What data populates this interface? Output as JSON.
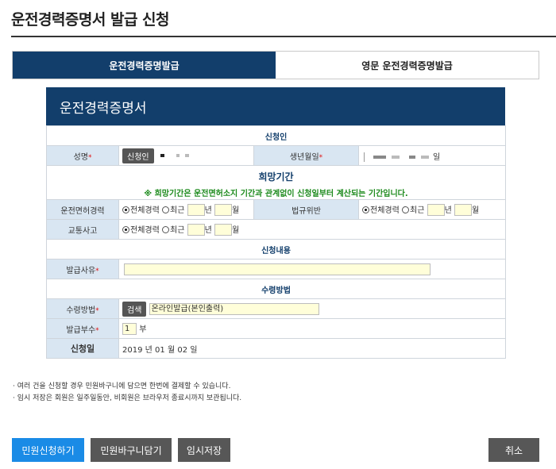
{
  "page_title": "운전경력증명서 발급 신청",
  "tabs": [
    {
      "label": "운전경력증명발급",
      "active": true
    },
    {
      "label": "영문 운전경력증명발급",
      "active": false
    }
  ],
  "form": {
    "header": "운전경력증명서",
    "sections": {
      "applicant": "신청인",
      "period": "희망기간",
      "content": "신청내용",
      "receipt": "수령방법"
    },
    "applicant": {
      "name_label": "성명",
      "name_button": "신청인",
      "birth_label": "생년월일",
      "birth_day_unit": "일",
      "required_mark": "*"
    },
    "period": {
      "notice": "※ 희망기간은 운전면허소지 기간과 관계없이 신청일부터 계산되는 기간입니다.",
      "license_label": "운전면허경력",
      "violation_label": "법규위반",
      "accident_label": "교통사고",
      "opt_all": "전체경력",
      "opt_recent": "최근",
      "year_unit": "년",
      "month_unit": "월"
    },
    "content": {
      "reason_label": "발급사유",
      "reason_value": ""
    },
    "receipt": {
      "method_label": "수령방법",
      "search_button": "검색",
      "method_value": "온라인발급(본인출력)",
      "copies_label": "발급부수",
      "copies_value": "1",
      "copies_unit": "부",
      "date_label": "신청일",
      "date_year": "2019",
      "date_year_unit": "년",
      "date_month": "01",
      "date_month_unit": "월",
      "date_day": "02",
      "date_day_unit": "일"
    }
  },
  "notes": [
    "· 여러 건을 신청할 경우 민원바구니에 담으면 한번에 결제할 수 있습니다.",
    "· 임시 저장은 회원은 일주일동안, 비회원은 브라우저 종료시까지 보관됩니다."
  ],
  "buttons": {
    "submit": "민원신청하기",
    "cart": "민원바구니담기",
    "temp_save": "임시저장",
    "cancel": "취소"
  },
  "colors": {
    "primary": "#123e6b",
    "label_bg": "#d9e6f2",
    "required": "#e01010",
    "notice_green": "#1c8a1c",
    "submit_blue": "#1a8be6",
    "button_gray": "#575757",
    "input_yellow": "#fffed9"
  }
}
